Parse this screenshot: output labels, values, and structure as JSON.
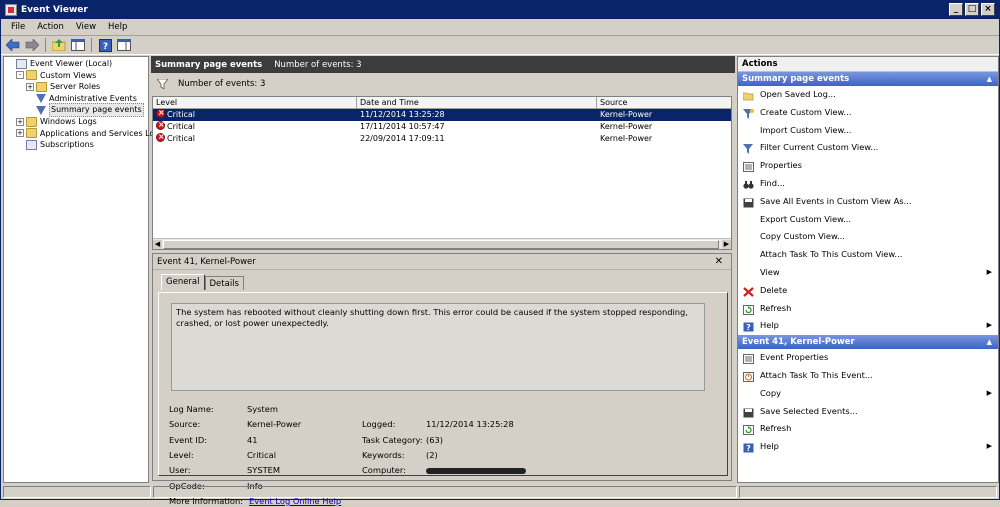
{
  "window": {
    "title": "Event Viewer"
  },
  "menu": [
    "File",
    "Action",
    "View",
    "Help"
  ],
  "tree": [
    {
      "label": "Event Viewer (Local)",
      "level": 0,
      "icon": "event-viewer-icon",
      "expander": ""
    },
    {
      "label": "Custom Views",
      "level": 1,
      "icon": "folder-icon",
      "expander": "-"
    },
    {
      "label": "Server Roles",
      "level": 2,
      "icon": "folder-icon",
      "expander": "+"
    },
    {
      "label": "Administrative Events",
      "level": 2,
      "icon": "filter-icon",
      "expander": ""
    },
    {
      "label": "Summary page events",
      "level": 2,
      "icon": "filter-icon",
      "expander": "",
      "selected": true
    },
    {
      "label": "Windows Logs",
      "level": 1,
      "icon": "folder-icon",
      "expander": "+"
    },
    {
      "label": "Applications and Services Logs",
      "level": 1,
      "icon": "folder-icon",
      "expander": "+"
    },
    {
      "label": "Subscriptions",
      "level": 1,
      "icon": "log-icon",
      "expander": ""
    }
  ],
  "middle": {
    "header_title": "Summary page events",
    "header_count": "Number of events: 3",
    "filter_text": "Number of events: 3",
    "columns": [
      "Level",
      "Date and Time",
      "Source"
    ],
    "rows": [
      {
        "level": "Critical",
        "datetime": "11/12/2014 13:25:28",
        "source": "Kernel-Power"
      },
      {
        "level": "Critical",
        "datetime": "17/11/2014 10:57:47",
        "source": "Kernel-Power"
      },
      {
        "level": "Critical",
        "datetime": "22/09/2014 17:09:11",
        "source": "Kernel-Power"
      }
    ]
  },
  "details": {
    "title": "Event 41, Kernel-Power",
    "tabs": [
      "General",
      "Details"
    ],
    "description": "The system has rebooted without cleanly shutting down first. This error could be caused if the system stopped responding, crashed, or lost power unexpectedly.",
    "labels": {
      "log_name": "Log Name:",
      "source": "Source:",
      "event_id": "Event ID:",
      "level": "Level:",
      "user": "User:",
      "opcode": "OpCode:",
      "more_info": "More Information:",
      "logged": "Logged:",
      "task_category": "Task Category:",
      "keywords": "Keywords:",
      "computer": "Computer:"
    },
    "values": {
      "log_name": "System",
      "source": "Kernel-Power",
      "event_id": "41",
      "level": "Critical",
      "user": "SYSTEM",
      "opcode": "Info",
      "more_info_link": "Event Log Online Help",
      "logged": "11/12/2014 13:25:28",
      "task_category": "(63)",
      "keywords": "(2)"
    }
  },
  "actions": {
    "title": "Actions",
    "section1": "Summary page events",
    "items1": [
      {
        "label": "Open Saved Log...",
        "icon": "open-folder-icon"
      },
      {
        "label": "Create Custom View...",
        "icon": "create-filter-icon"
      },
      {
        "label": "Import Custom View...",
        "icon": "none"
      },
      {
        "label": "Filter Current Custom View...",
        "icon": "filter-icon"
      },
      {
        "label": "Properties",
        "icon": "properties-icon"
      },
      {
        "label": "Find...",
        "icon": "binoculars-icon"
      },
      {
        "label": "Save All Events in Custom View As...",
        "icon": "save-icon"
      },
      {
        "label": "Export Custom View...",
        "icon": "none"
      },
      {
        "label": "Copy Custom View...",
        "icon": "none"
      },
      {
        "label": "Attach Task To This Custom View...",
        "icon": "none"
      },
      {
        "label": "View",
        "icon": "none",
        "submenu": true
      },
      {
        "label": "Delete",
        "icon": "delete-icon"
      },
      {
        "label": "Refresh",
        "icon": "refresh-icon"
      },
      {
        "label": "Help",
        "icon": "help-icon",
        "submenu": true
      }
    ],
    "section2": "Event 41, Kernel-Power",
    "items2": [
      {
        "label": "Event Properties",
        "icon": "properties-icon"
      },
      {
        "label": "Attach Task To This Event...",
        "icon": "task-icon"
      },
      {
        "label": "Copy",
        "icon": "none",
        "submenu": true
      },
      {
        "label": "Save Selected Events...",
        "icon": "save-icon"
      },
      {
        "label": "Refresh",
        "icon": "refresh-icon"
      },
      {
        "label": "Help",
        "icon": "help-icon",
        "submenu": true
      }
    ]
  }
}
